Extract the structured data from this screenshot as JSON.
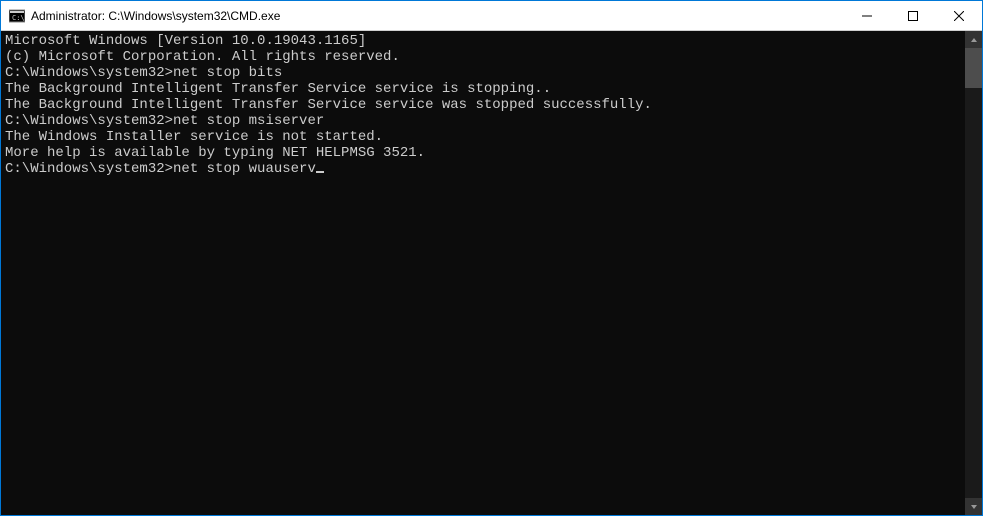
{
  "titlebar": {
    "title": "Administrator: C:\\Windows\\system32\\CMD.exe"
  },
  "console": {
    "line_version": "Microsoft Windows [Version 10.0.19043.1165]",
    "line_copyright": "(c) Microsoft Corporation. All rights reserved.",
    "blank1": "",
    "prompt1": "C:\\Windows\\system32>",
    "cmd1": "net stop bits",
    "out1a": "The Background Intelligent Transfer Service service is stopping..",
    "out1b": "The Background Intelligent Transfer Service service was stopped successfully.",
    "blank2": "",
    "blank3": "",
    "prompt2": "C:\\Windows\\system32>",
    "cmd2": "net stop msiserver",
    "out2a": "The Windows Installer service is not started.",
    "blank4": "",
    "out2b": "More help is available by typing NET HELPMSG 3521.",
    "blank5": "",
    "blank6": "",
    "prompt3": "C:\\Windows\\system32>",
    "cmd3": "net stop wuauserv"
  }
}
